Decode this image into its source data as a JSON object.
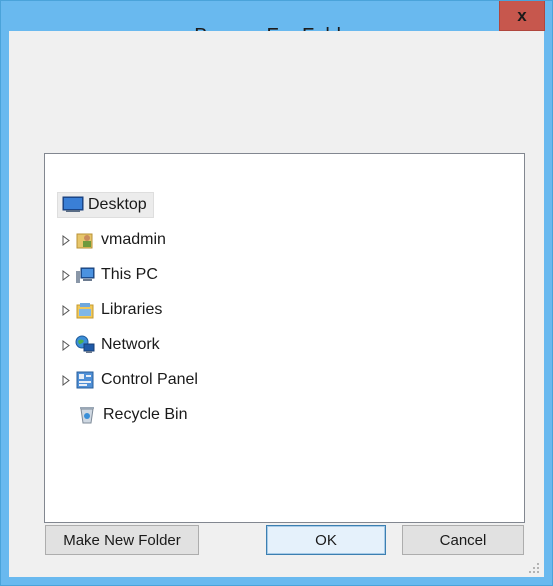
{
  "window": {
    "title": "Browse For Folder",
    "close_label": "x"
  },
  "tree": {
    "items": [
      {
        "label": "Desktop",
        "icon": "desktop-icon",
        "expandable": false,
        "selected": true
      },
      {
        "label": "vmadmin",
        "icon": "user-folder-icon",
        "expandable": true,
        "selected": false
      },
      {
        "label": "This PC",
        "icon": "computer-icon",
        "expandable": true,
        "selected": false
      },
      {
        "label": "Libraries",
        "icon": "libraries-icon",
        "expandable": true,
        "selected": false
      },
      {
        "label": "Network",
        "icon": "network-icon",
        "expandable": true,
        "selected": false
      },
      {
        "label": "Control Panel",
        "icon": "control-panel-icon",
        "expandable": true,
        "selected": false
      },
      {
        "label": "Recycle Bin",
        "icon": "recycle-bin-icon",
        "expandable": false,
        "selected": false
      }
    ]
  },
  "buttons": {
    "make_new_folder": "Make New Folder",
    "ok": "OK",
    "cancel": "Cancel"
  },
  "colors": {
    "frame": "#69b9ef",
    "close": "#c7574d",
    "client": "#f0f0f0"
  }
}
